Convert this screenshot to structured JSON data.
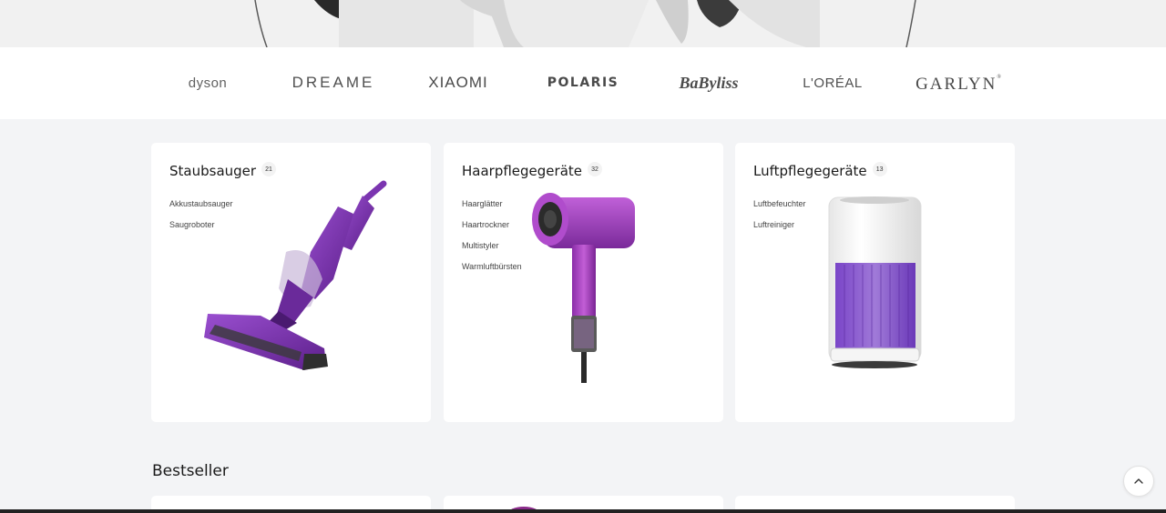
{
  "hero": {
    "image": "grayscale-photo-people"
  },
  "brands": [
    "dyson",
    "DREAME",
    "XIAOMI",
    "POLARIS",
    "BaByliss",
    "L'ORÉAL",
    "GARLYN"
  ],
  "categories": [
    {
      "title": "Staubsauger",
      "count": "21",
      "links": [
        "Akkustaubsauger",
        "Saugroboter"
      ],
      "image": "vacuum-cleaner-image"
    },
    {
      "title": "Haarpflegegeräte",
      "count": "32",
      "links": [
        "Haarglätter",
        "Haartrockner",
        "Multistyler",
        "Warmluftbürsten"
      ],
      "image": "hair-dryer-image"
    },
    {
      "title": "Luftpflegegeräte",
      "count": "13",
      "links": [
        "Luftbefeuchter",
        "Luftreiniger"
      ],
      "image": "air-purifier-image"
    }
  ],
  "bestseller": {
    "title": "Bestseller"
  },
  "scroll_top": {
    "icon": "chevron-up-icon"
  },
  "colors": {
    "accent": "#7b2fa8",
    "background": "#f3f4f6",
    "card": "#ffffff"
  }
}
